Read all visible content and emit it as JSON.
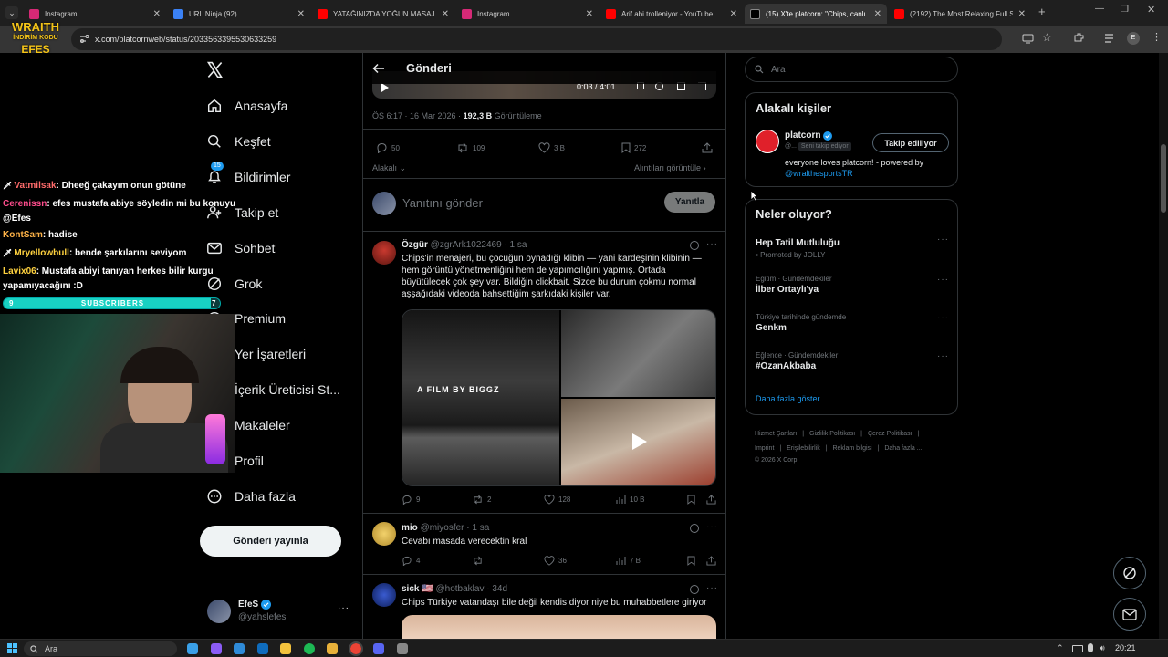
{
  "tabs": [
    {
      "title": "Instagram",
      "color": "#d62976"
    },
    {
      "title": "URL Ninja (92)",
      "color": "#3b82f6"
    },
    {
      "title": "YATAĞINIZDA YOĞUN MASAJ...",
      "color": "#ff0000"
    },
    {
      "title": "Instagram",
      "color": "#d62976"
    },
    {
      "title": "Arif abi trolleniyor - YouTube",
      "color": "#ff0000"
    },
    {
      "title": "(15) X'te platcorn: \"Chips, canlı",
      "color": "#000000"
    },
    {
      "title": "(2192) The Most Relaxing Full S",
      "color": "#ff0000"
    }
  ],
  "url": "x.com/platcornweb/status/2033563395530633259",
  "nav": {
    "items": [
      "Anasayfa",
      "Keşfet",
      "Bildirimler",
      "Takip et",
      "Sohbet",
      "Grok",
      "Premium",
      "Yer İşaretleri",
      "İçerik Üreticisi St...",
      "Makaleler",
      "Profil",
      "Daha fazla"
    ],
    "notif_badge": "15",
    "post_button": "Gönderi yayınla",
    "profile_name": "EfeS",
    "profile_handle": "@yahslefes"
  },
  "header": {
    "title": "Gönderi"
  },
  "video": {
    "time": "0:03 / 4:01"
  },
  "post": {
    "meta_time": "ÖS 6:17 · 16 Mar 2026 · ",
    "views": "192,3 B",
    "views_label": " Görüntüleme",
    "replies": "50",
    "reposts": "109",
    "likes": "3 B",
    "bookmarks": "272",
    "relevant": "Alakalı",
    "quotes": "Alıntıları görüntüle"
  },
  "reply_box": {
    "placeholder": "Yanıtını gönder",
    "button": "Yanıtla"
  },
  "replies": [
    {
      "name": "Özgür",
      "handle": "@zgrArk1022469 · 1 sa",
      "text": "Chips'in menajeri, bu çocuğun oynadığı klibin — yani kardeşinin klibinin — hem görüntü yönetmenliğini hem de yapımcılığını yapmış. Ortada büyütülecek çok şey var. Bildiğin clickbait. Sizce bu durum çokmu normal aşşağıdaki videoda bahsettiğim şarkıdaki kişiler var.",
      "film_text": "A FILM BY BIGGZ",
      "replies": "9",
      "reposts": "2",
      "likes": "128",
      "views": "10 B"
    },
    {
      "name": "mio",
      "handle": "@miyosfer · 1 sa",
      "text": "Cevabı masada verecektin kral",
      "replies": "4",
      "reposts": "",
      "likes": "36",
      "views": "7 B"
    },
    {
      "name": "sick 🇺🇸",
      "handle": "@hotbaklav · 34d",
      "text": "Chips Türkiye vatandaşı bile değil kendis diyor niye bu muhabbetlere giriyor"
    }
  ],
  "search": {
    "placeholder": "Ara"
  },
  "relevant_people": {
    "title": "Alakalı kişiler",
    "name": "platcorn",
    "handle": "@...",
    "follows_you": "Seni takip ediyor",
    "button": "Takip ediliyor",
    "bio": "everyone loves platcorn! - powered by ",
    "bio_link": "@wralthesportsTR"
  },
  "trends": {
    "title": "Neler oluyor?",
    "items": [
      {
        "category": "",
        "name": "Hep Tatil Mutluluğu",
        "promo": "Promoted by JOLLY"
      },
      {
        "category": "Eğitim · Gündemdekiler",
        "name": "İlber Ortaylı'ya"
      },
      {
        "category": "Türkiye tarihinde gündemde",
        "name": "Genkm"
      },
      {
        "category": "Eğlence · Gündemdekiler",
        "name": "#OzanAkbaba"
      }
    ],
    "show_more": "Daha fazla göster"
  },
  "footer": {
    "links": [
      "Hizmet Şartları",
      "Gizlilik Politikası",
      "Çerez Politikası",
      "Imprint",
      "Erişilebilirlik",
      "Reklam bilgisi",
      "Daha fazla ..."
    ],
    "copyright": "© 2026 X Corp."
  },
  "stream": {
    "logo_top": "WRAITH",
    "logo_mid": "İNDİRİM KODU",
    "logo_bottom": "EFES",
    "subs_left": "9",
    "subs_label": "SUBSCRIBERS",
    "subs_right": "7",
    "subs_progress": 0.95,
    "chat": [
      {
        "user": "Vatmilsak",
        "color": "#ff6b6b",
        "icon": true,
        "msg": ": Dheeğ çakayım onun götüne"
      },
      {
        "user": "Cerenissn",
        "color": "#ff4d8d",
        "icon": false,
        "msg": ": efes mustafa abiye söyledin mi bu konuyu @Efes"
      },
      {
        "user": "KontSam",
        "color": "#ffb347",
        "icon": false,
        "msg": ": hadise"
      },
      {
        "user": "Mryellowbull",
        "color": "#ffd23f",
        "icon": true,
        "msg": ": bende şarkılarını seviyom"
      },
      {
        "user": "Lavix06",
        "color": "#ffd23f",
        "icon": false,
        "msg": ": Mustafa abiyi tanıyan herkes bilir kurgu yapamıyacağını :D"
      }
    ]
  },
  "taskbar": {
    "search": "Ara",
    "time": "20:21"
  }
}
